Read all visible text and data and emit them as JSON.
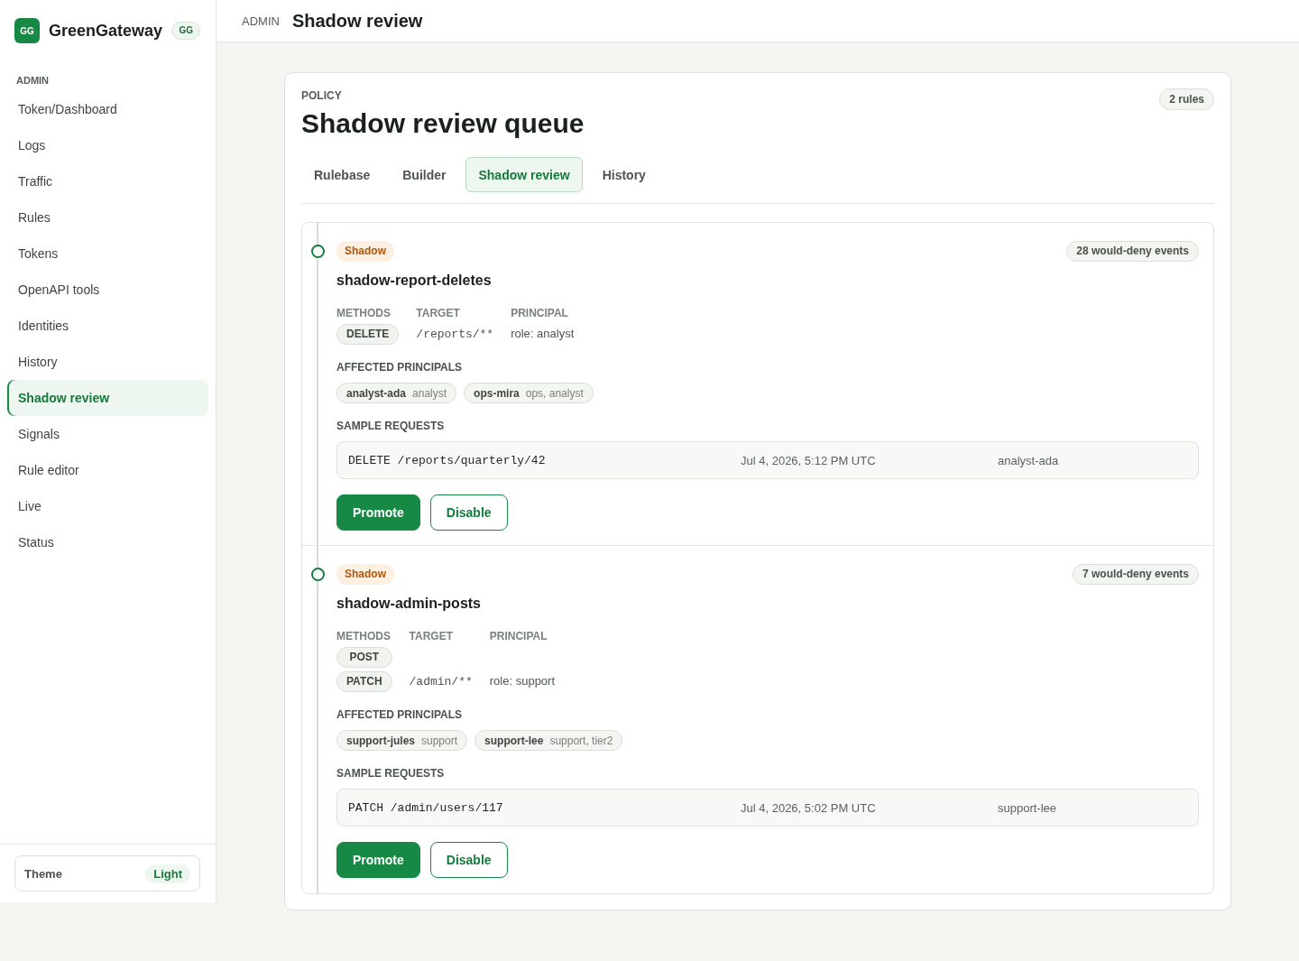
{
  "sidebar": {
    "brand": {
      "mark": "GG",
      "name": "GreenGateway",
      "badge": "GG"
    },
    "section": "ADMIN",
    "items": [
      {
        "label": "Token/Dashboard",
        "selected": false
      },
      {
        "label": "Logs",
        "selected": false
      },
      {
        "label": "Traffic",
        "selected": false
      },
      {
        "label": "Rules",
        "selected": false
      },
      {
        "label": "Tokens",
        "selected": false
      },
      {
        "label": "OpenAPI tools",
        "selected": false
      },
      {
        "label": "Identities",
        "selected": false
      },
      {
        "label": "History",
        "selected": false
      },
      {
        "label": "Shadow review",
        "selected": true
      },
      {
        "label": "Signals",
        "selected": false
      },
      {
        "label": "Rule editor",
        "selected": false
      },
      {
        "label": "Live",
        "selected": false
      },
      {
        "label": "Status",
        "selected": false
      }
    ],
    "theme": {
      "label": "Theme",
      "value": "Light"
    }
  },
  "topbar": {
    "section": "ADMIN",
    "title": "Shadow review"
  },
  "panel": {
    "eyebrow": "POLICY",
    "title": "Shadow review queue",
    "count": "2 rules",
    "tabs": [
      {
        "label": "Rulebase",
        "selected": false
      },
      {
        "label": "Builder",
        "selected": false
      },
      {
        "label": "Shadow review",
        "selected": true
      },
      {
        "label": "History",
        "selected": false
      }
    ],
    "rules": [
      {
        "status": "Shadow",
        "events": "28 would-deny events",
        "name": "shadow-report-deletes",
        "methods": {
          "label": "METHODS",
          "values": [
            "DELETE"
          ]
        },
        "target": {
          "label": "TARGET",
          "value": "/reports/**"
        },
        "principal": {
          "label": "PRINCIPAL",
          "value": "role: analyst"
        },
        "affected_principals": {
          "label": "AFFECTED PRINCIPALS",
          "items": [
            {
              "name": "analyst-ada",
              "roles": "analyst"
            },
            {
              "name": "ops-mira",
              "roles": "ops, analyst"
            }
          ]
        },
        "sample_requests": {
          "label": "SAMPLE REQUESTS",
          "rows": [
            {
              "request": "DELETE /reports/quarterly/42",
              "time": "Jul 4, 2026, 5:12 PM UTC",
              "principal": "analyst-ada"
            }
          ]
        },
        "actions": [
          {
            "label": "Promote",
            "kind": "primary"
          },
          {
            "label": "Disable",
            "kind": "secondary"
          }
        ]
      },
      {
        "status": "Shadow",
        "events": "7 would-deny events",
        "name": "shadow-admin-posts",
        "methods": {
          "label": "METHODS",
          "values": [
            "POST",
            "PATCH"
          ]
        },
        "target": {
          "label": "TARGET",
          "value": "/admin/**"
        },
        "principal": {
          "label": "PRINCIPAL",
          "value": "role: support"
        },
        "affected_principals": {
          "label": "AFFECTED PRINCIPALS",
          "items": [
            {
              "name": "support-jules",
              "roles": "support"
            },
            {
              "name": "support-lee",
              "roles": "support, tier2"
            }
          ]
        },
        "sample_requests": {
          "label": "SAMPLE REQUESTS",
          "rows": [
            {
              "request": "PATCH /admin/users/117",
              "time": "Jul 4, 2026, 5:02 PM UTC",
              "principal": "support-lee"
            }
          ]
        },
        "actions": [
          {
            "label": "Promote",
            "kind": "primary"
          },
          {
            "label": "Disable",
            "kind": "secondary"
          }
        ]
      }
    ]
  }
}
